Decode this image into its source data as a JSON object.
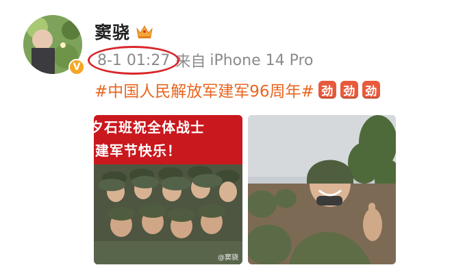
{
  "post": {
    "username": "窦骁",
    "timestamp": "8-1 01:27",
    "source_prefix": "来自",
    "source_device": "iPhone 14 Pro",
    "hashtag": "#中国人民解放军建军96周年#",
    "emoji_badges": [
      "劲",
      "劲",
      "劲"
    ],
    "verified_badge": "V",
    "highlight_color": "#d8262b",
    "hashtag_color": "#e8651f"
  },
  "images": {
    "left": {
      "banner_line_1": "夕石班祝全体战士",
      "banner_line_2": "l建军节快乐！",
      "watermark": "@窦骁"
    }
  },
  "icons": {
    "crown": "crown-icon",
    "verified": "verified-badge-icon"
  }
}
